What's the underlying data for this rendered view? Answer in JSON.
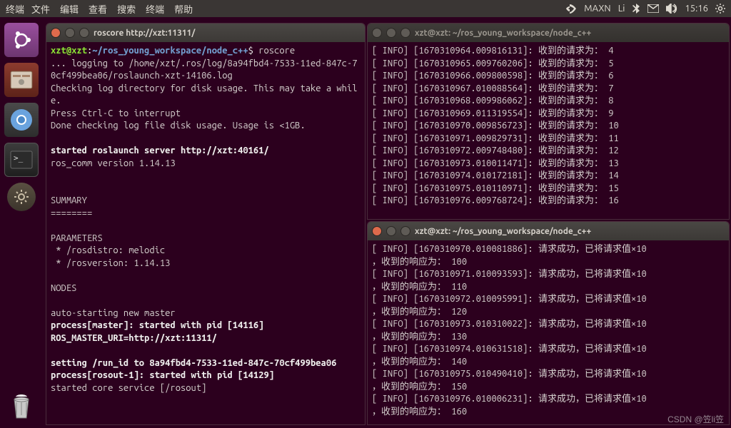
{
  "topbar": {
    "app": "终端",
    "menus": [
      "文件",
      "编辑",
      "查看",
      "搜索",
      "终端",
      "帮助"
    ],
    "maxn": "MAXN",
    "battery": "Li",
    "clock": "15:16"
  },
  "launcher": {
    "items": [
      "ubuntu-dash",
      "file-manager",
      "chromium",
      "terminal",
      "settings"
    ],
    "trash": "trash"
  },
  "term1": {
    "title": "roscore http://xzt:11311/",
    "prompt_user": "xzt@xzt",
    "prompt_path": "~/ros_young_workspace/node_c++",
    "command": "roscore",
    "lines": [
      "... logging to /home/xzt/.ros/log/8a94fbd4-7533-11ed-847c-70cf499bea06/roslaunch-xzt-14106.log",
      "Checking log directory for disk usage. This may take a while.",
      "Press Ctrl-C to interrupt",
      "Done checking log file disk usage. Usage is <1GB.",
      "",
      "__started roslaunch server http://xzt:40161/__",
      "ros_comm version 1.14.13",
      "",
      "",
      "SUMMARY",
      "========",
      "",
      "PARAMETERS",
      " * /rosdistro: melodic",
      " * /rosversion: 1.14.13",
      "",
      "NODES",
      "",
      "auto-starting new master",
      "__process[master]: started with pid [14116]__",
      "__ROS_MASTER_URI=http://xzt:11311/__",
      "",
      "__setting /run_id to 8a94fbd4-7533-11ed-847c-70cf499bea06__",
      "__process[rosout-1]: started with pid [14129]__",
      "started core service [/rosout]"
    ]
  },
  "term2": {
    "title": "xzt@xzt: ~/ros_young_workspace/node_c++",
    "entries": [
      {
        "ts": "1670310964.009816131",
        "val": 4
      },
      {
        "ts": "1670310965.009760206",
        "val": 5
      },
      {
        "ts": "1670310966.009800598",
        "val": 6
      },
      {
        "ts": "1670310967.010088564",
        "val": 7
      },
      {
        "ts": "1670310968.009986062",
        "val": 8
      },
      {
        "ts": "1670310969.011319554",
        "val": 9
      },
      {
        "ts": "1670310970.009856723",
        "val": 10
      },
      {
        "ts": "1670310971.009829731",
        "val": 11
      },
      {
        "ts": "1670310972.009748480",
        "val": 12
      },
      {
        "ts": "1670310973.010011471",
        "val": 13
      },
      {
        "ts": "1670310974.010172181",
        "val": 14
      },
      {
        "ts": "1670310975.010110971",
        "val": 15
      },
      {
        "ts": "1670310976.009768724",
        "val": 16
      }
    ],
    "label_prefix": "收到的请求为："
  },
  "term3": {
    "title": "xzt@xzt: ~/ros_young_workspace/node_c++",
    "entries": [
      {
        "ts": "1670310970.010081886",
        "resp": 100
      },
      {
        "ts": "1670310971.010093593",
        "resp": 110
      },
      {
        "ts": "1670310972.010095991",
        "resp": 120
      },
      {
        "ts": "1670310973.010310022",
        "resp": 130
      },
      {
        "ts": "1670310974.010631518",
        "resp": 140
      },
      {
        "ts": "1670310975.010490410",
        "resp": 150
      },
      {
        "ts": "1670310976.010006231",
        "resp": 160
      }
    ],
    "line1": "请求成功，已将请求值×10",
    "line2_prefix": "，收到的响应为："
  },
  "watermark": "CSDN @笠li笠"
}
